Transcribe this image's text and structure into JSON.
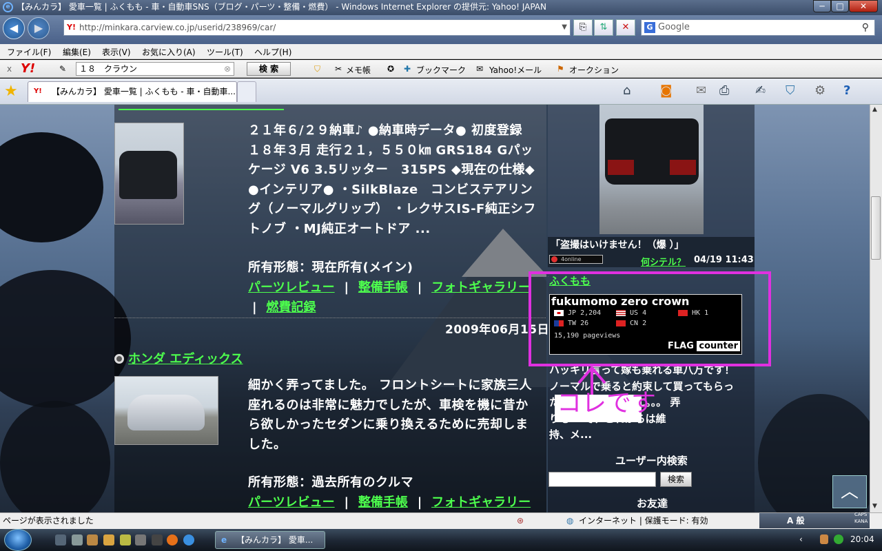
{
  "window": {
    "title": "【みんカラ】 愛車一覧 | ふくもも - 車・自動車SNS（ブログ・パーツ・整備・燃費） - Windows Internet Explorer の提供元: Yahoo! JAPAN",
    "min": "─",
    "max": "□",
    "close": "✕"
  },
  "address": {
    "url": "http://minkara.carview.co.jp/userid/238969/car/",
    "favicon": "Y!",
    "search_provider": "Google",
    "search_placeholder": "Google"
  },
  "menu": [
    "ファイル(F)",
    "編集(E)",
    "表示(V)",
    "お気に入り(A)",
    "ツール(T)",
    "ヘルプ(H)"
  ],
  "yahoo_toolbar": {
    "close": "x",
    "logo": "Y!",
    "query": "１８　クラウン",
    "search_btn": "検 索",
    "items": [
      "メモ帳",
      "ブックマーク",
      "Yahoo!メール",
      "オークション"
    ]
  },
  "tab": {
    "favicon": "Y!",
    "label": "【みんカラ】 愛車一覧 | ふくもも - 車・自動車..."
  },
  "main": {
    "car1_desc": [
      "２１年６/２９納車♪ ●納車時データ● 初度登録",
      "１８年３月 走行２１，５５０㎞ GRS184 Gパッ",
      "ケージ V6 3.5リッター　315PS ◆現在の仕様◆",
      "●インテリア● ・SilkBlaze　コンビステアリン",
      "グ（ノーマルグリップ） ・レクサスIS-F純正シフ",
      "トノブ ・MJ純正オートドア ..."
    ],
    "car1_owner": "所有形態：現在所有(メイン)",
    "links": [
      "パーツレビュー",
      "整備手帳",
      "フォトギャラリー",
      "燃費記録"
    ],
    "sep": "|",
    "date": "2009年06月15日",
    "car2_name": "ホンダ エディックス",
    "car2_desc": [
      "細かく弄ってました。 フロントシートに家族三人",
      "座れるのは非常に魅力でしたが、車検を機に昔か",
      "ら欲しかったセダンに乗り換えるために売却しま",
      "した。"
    ],
    "car2_owner": "所有形態：過去所有のクルマ"
  },
  "side": {
    "photo_caption": "「盗撮はいけません！（爆 ）」",
    "online_label": "4online",
    "nani_link": "何シテル？",
    "timestamp": "04/19 11:43",
    "user_link": "ふくもも",
    "flag_counter": {
      "title": "fukumomo zero crown",
      "rows": [
        {
          "code": "JP",
          "count": "2,204"
        },
        {
          "code": "US",
          "count": "4"
        },
        {
          "code": "HK",
          "count": "1"
        },
        {
          "code": "TW",
          "count": "26"
        },
        {
          "code": "CN",
          "count": "2"
        }
      ],
      "pageviews": "15,190 pageviews",
      "logo_flag": "FLAG",
      "logo_counter": "counter"
    },
    "intro": [
      "ハッキリ言って嫁も乗れる車八万です！",
      "ノーマルで乗ると約束して買ってもらっ",
      "たのに… こんな事に。。。 弄",
      "りも… で、これからは維",
      "持、メ..."
    ],
    "search_heading": "ユーザー内検索",
    "search_btn": "検索",
    "friends_heading": "お友達"
  },
  "annotation": {
    "text": "コレです",
    "color": "#e030e0"
  },
  "status": {
    "text": "ページが表示されました",
    "zone": "インターネット | 保護モード: 有効"
  },
  "taskbar": {
    "task_label": "【みんカラ】 愛車...",
    "clock": "20:04",
    "ime": "A 般",
    "caps": "CAPS",
    "kana": "KANA"
  }
}
